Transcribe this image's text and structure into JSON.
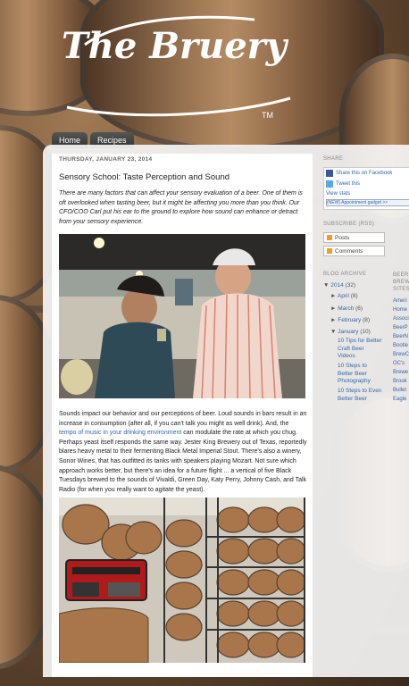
{
  "header": {
    "logo_text": "The Bruery",
    "tm": "TM"
  },
  "nav": {
    "tabs": [
      "Home",
      "Recipes"
    ]
  },
  "post": {
    "date": "THURSDAY, JANUARY 23, 2014",
    "title": "Sensory School: Taste Perception and Sound",
    "intro": "There are many factors that can affect your sensory evaluation of a beer. One of them is oft overlooked when tasting beer, but it might be affecting you more than you think. Our CFO/COO Carl put his ear to the ground to explore how sound can enhance or detract from your sensory experience.",
    "body_p1": "Sounds impact our behavior and our perceptions of beer. Loud sounds in bars result in an increase in consumption (after all, if you can't talk you might as well drink). And, the ",
    "body_link": "tempo of music in your drinking environment",
    "body_p2": " can modulate the rate at which you chug. Perhaps yeast itself responds the same way. Jester King Brewery out of Texas, reportedly blares heavy metal to their fermenting Black Metal Imperial Stout. There's also a winery, Sonor Wines, that has outfitted its tanks with speakers playing Mozart. Not sure which approach works better, but there's an idea for a future flight ... a vertical of five Black Tuesdays brewed to the sounds of Vivaldi, Green Day, Katy Perry, Johnny Cash, and Talk Radio (for when you really want to agitate the yeast)."
  },
  "sidebar": {
    "share": {
      "heading": "SHARE",
      "facebook": "Share this on Facebook",
      "twitter": "Tweet this",
      "view_stats": "View stats",
      "gadget": "(NEW) Appointment gadget >>"
    },
    "subscribe": {
      "heading": "SUBSCRIBE (RSS)",
      "posts": "Posts",
      "comments": "Comments"
    },
    "archive": {
      "heading": "BLOG ARCHIVE",
      "year": "2014",
      "year_count": "(32)",
      "months": [
        {
          "arrow": "►",
          "label": "April",
          "count": "(8)"
        },
        {
          "arrow": "►",
          "label": "March",
          "count": "(6)"
        },
        {
          "arrow": "►",
          "label": "February",
          "count": "(8)"
        },
        {
          "arrow": "▼",
          "label": "January",
          "count": "(10)"
        }
      ],
      "posts": [
        "10 Tips for Better Craft Beer Videos",
        "10 Steps to Better Beer Photography",
        "10 Steps to Even Better Beer"
      ]
    },
    "sites": {
      "heading": "BEER BREW SITES",
      "items": [
        "Ameri",
        "Home",
        "Associ",
        "BeerP",
        "BeerN",
        "Bootle",
        "BrewC",
        "OC's",
        "Brewe",
        "Brook",
        "Bullet",
        "Eagle"
      ]
    }
  },
  "colors": {
    "link": "#3366aa",
    "accent_orange": "#f39a2b"
  }
}
